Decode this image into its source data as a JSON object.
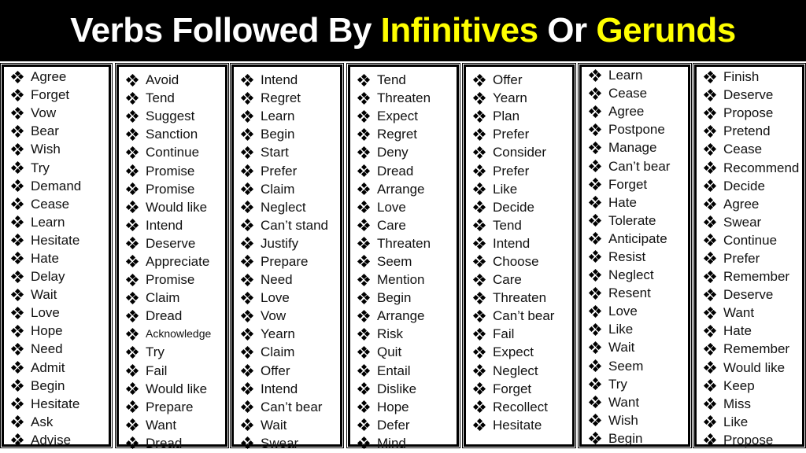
{
  "title": {
    "part1": "Verbs Followed By ",
    "part2": "Infinitives",
    "part3": " Or ",
    "part4": "Gerunds"
  },
  "colors": {
    "title_background": "#000000",
    "title_text": "#ffffff",
    "highlight": "#ffff00"
  },
  "bullet_icon": "diamond-four-dots-icon",
  "columns": [
    {
      "items": [
        "Agree",
        "Forget",
        "Vow",
        "Bear",
        "Wish",
        "Try",
        "Demand",
        "Cease",
        "Learn",
        "Hesitate",
        "Hate",
        "Delay",
        "Wait",
        "Love",
        "Hope",
        "Need",
        "Admit",
        "Begin",
        "Hesitate",
        "Ask",
        "Advise"
      ]
    },
    {
      "items": [
        "Avoid",
        "Tend",
        "Suggest",
        "Sanction",
        "Continue",
        "Promise",
        "Promise",
        "Would like",
        "Intend",
        "Deserve",
        "Appreciate",
        "Promise",
        "Claim",
        "Dread",
        "Acknowledge",
        "Try",
        "Fail",
        "Would like",
        "Prepare",
        "Want",
        "Dread"
      ]
    },
    {
      "items": [
        "Intend",
        "Regret",
        "Learn",
        "Begin",
        "Start",
        "Prefer",
        "Claim",
        "Neglect",
        "Can’t stand",
        "Justify",
        "Prepare",
        "Need",
        "Love",
        "Vow",
        "Yearn",
        "Claim",
        "Offer",
        "Intend",
        "Can’t bear",
        "Wait",
        "Swear"
      ]
    },
    {
      "items": [
        "Tend",
        "Threaten",
        "Expect",
        "Regret",
        "Deny",
        "Dread",
        "Arrange",
        "Love",
        "Care",
        "Threaten",
        "Seem",
        "Mention",
        "Begin",
        "Arrange",
        "Risk",
        "Quit",
        "Entail",
        "Dislike",
        "Hope",
        "Defer",
        "Mind"
      ]
    },
    {
      "items": [
        "Offer",
        "Yearn",
        "Plan",
        "Prefer",
        "Consider",
        "Prefer",
        "Like",
        "Decide",
        "Tend",
        "Intend",
        "Choose",
        "Care",
        "Threaten",
        "Can’t bear",
        "Fail",
        "Expect",
        "Neglect",
        "Forget",
        "Recollect",
        "Hesitate"
      ]
    },
    {
      "items": [
        "Learn",
        "Cease",
        "Agree",
        "Postpone",
        "Manage",
        "Can’t bear",
        "Forget",
        "Hate",
        "Tolerate",
        "Anticipate",
        "Resist",
        "Neglect",
        "Resent",
        "Love",
        "Like",
        "Wait",
        "Seem",
        "Try",
        "Want",
        "Wish",
        "Begin"
      ]
    },
    {
      "items": [
        "Finish",
        "Deserve",
        "Propose",
        "Pretend",
        "Cease",
        "Recommend",
        "Decide",
        "Agree",
        "Swear",
        "Continue",
        "Prefer",
        "Remember",
        "Deserve",
        "Want",
        "Hate",
        "Remember",
        "Would like",
        "Keep",
        "Miss",
        "Like",
        "Propose"
      ]
    }
  ]
}
